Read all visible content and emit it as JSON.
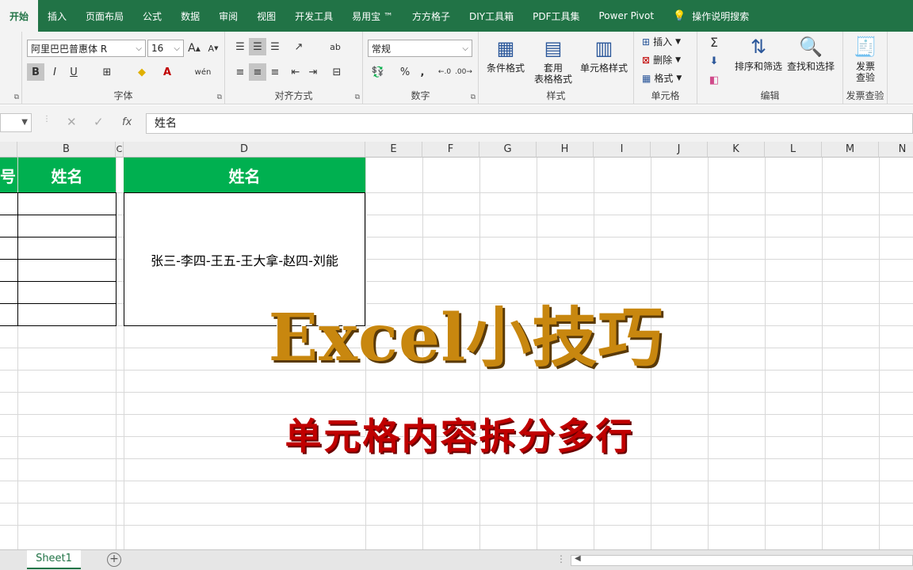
{
  "tabs": [
    "开始",
    "插入",
    "页面布局",
    "公式",
    "数据",
    "审阅",
    "视图",
    "开发工具",
    "易用宝 ™",
    "方方格子",
    "DIY工具箱",
    "PDF工具集",
    "Power Pivot"
  ],
  "tell_me": "操作说明搜索",
  "font": {
    "name": "阿里巴巴普惠体 R",
    "size": "16",
    "increase_label": "A",
    "decrease_label": "A",
    "bold_label": "B",
    "italic_label": "I",
    "underline_label": "U",
    "phonetic_label": "wén",
    "group_label": "字体"
  },
  "align": {
    "group_label": "对齐方式",
    "wrap_label": "ab"
  },
  "number": {
    "format": "常规",
    "percent": "%",
    "comma": ",",
    "group_label": "数字"
  },
  "styles": {
    "conditional": "条件格式",
    "table_line1": "套用",
    "table_line2": "表格格式",
    "cell_styles": "单元格样式",
    "group_label": "样式"
  },
  "cells": {
    "insert": "插入",
    "delete": "删除",
    "format": "格式",
    "group_label": "单元格"
  },
  "editing": {
    "sum": "Σ",
    "sort_filter": "排序和筛选",
    "find_select": "查找和选择",
    "group_label": "编辑"
  },
  "invoice": {
    "line1": "发票",
    "line2": "查验",
    "group_label": "发票查验"
  },
  "formula_bar": {
    "cancel": "✕",
    "confirm": "✓",
    "fx": "fx",
    "value": "姓名"
  },
  "columns": [
    "B",
    "C",
    "D",
    "E",
    "F",
    "G",
    "H",
    "I",
    "J",
    "K",
    "L",
    "M",
    "N"
  ],
  "sheet": {
    "header_partial": "号",
    "header_b": "姓名",
    "header_d": "姓名",
    "merged_text": "张三-李四-王五-王大拿-赵四-刘能"
  },
  "overlay": {
    "title": "Excel小技巧",
    "subtitle": "单元格内容拆分多行"
  },
  "sheet_tab": "Sheet1",
  "colors": {
    "ribbon_green": "#217346",
    "header_green": "#00b050",
    "title_gold": "#c8870f",
    "subtitle_red": "#c00000"
  }
}
